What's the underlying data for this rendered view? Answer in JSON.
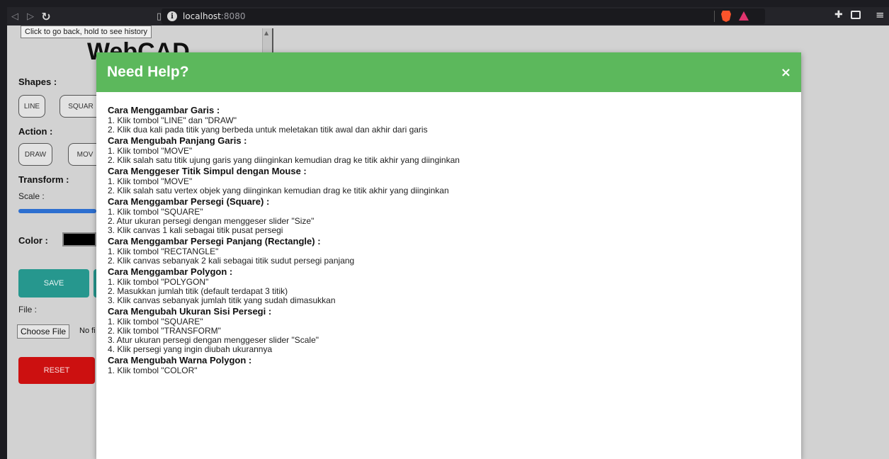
{
  "browser": {
    "url_host": "localhost",
    "url_port": ":8080",
    "tooltip": "Click to go back, hold to see history"
  },
  "app": {
    "title": "WebCAD",
    "shapes_label": "Shapes :",
    "shape_buttons": [
      "LINE",
      "SQUAR"
    ],
    "action_label": "Action :",
    "action_buttons": [
      "DRAW",
      "MOV"
    ],
    "transform_label": "Transform :",
    "scale_label": "Scale :",
    "color_label": "Color :",
    "color_value": "#000000",
    "save_label": "SAVE",
    "file_label": "File :",
    "choose_file_label": "Choose File",
    "file_status": "No fi",
    "reset_label": "RESET"
  },
  "modal": {
    "title": "Need Help?",
    "close_glyph": "×",
    "sections": [
      {
        "title": "Cara Menggambar Garis :",
        "steps": [
          "1. Klik tombol \"LINE\" dan \"DRAW\"",
          "2. Klik dua kali pada titik yang berbeda untuk meletakan titik awal dan akhir dari garis"
        ]
      },
      {
        "title": "Cara Mengubah Panjang Garis :",
        "steps": [
          "1. Klik tombol \"MOVE\"",
          "2. Klik salah satu titik ujung garis yang diinginkan kemudian drag ke titik akhir yang diinginkan"
        ]
      },
      {
        "title": "Cara Menggeser Titik Simpul dengan Mouse :",
        "steps": [
          "1. Klik tombol \"MOVE\"",
          "2. Klik salah satu vertex objek yang diinginkan kemudian drag ke titik akhir yang diinginkan"
        ]
      },
      {
        "title": "Cara Menggambar Persegi (Square) :",
        "steps": [
          "1. Klik tombol \"SQUARE\"",
          "2. Atur ukuran persegi dengan menggeser slider \"Size\"",
          "3. Klik canvas 1 kali sebagai titik pusat persegi"
        ]
      },
      {
        "title": "Cara Menggambar Persegi Panjang (Rectangle) :",
        "steps": [
          "1. Klik tombol \"RECTANGLE\"",
          "2. Klik canvas sebanyak 2 kali sebagai titik sudut persegi panjang"
        ]
      },
      {
        "title": "Cara Menggambar Polygon :",
        "steps": [
          "1. Klik tombol \"POLYGON\"",
          "2. Masukkan jumlah titik (default terdapat 3 titik)",
          "3. Klik canvas sebanyak jumlah titik yang sudah dimasukkan"
        ]
      },
      {
        "title": "Cara Mengubah Ukuran Sisi Persegi :",
        "steps": [
          "1. Klik tombol \"SQUARE\"",
          "2. Klik tombol \"TRANSFORM\"",
          "3. Atur ukuran persegi dengan menggeser slider \"Scale\"",
          "4. Klik persegi yang ingin diubah ukurannya"
        ]
      },
      {
        "title": "Cara Mengubah Warna Polygon :",
        "steps": [
          "1. Klik tombol \"COLOR\""
        ]
      }
    ]
  }
}
